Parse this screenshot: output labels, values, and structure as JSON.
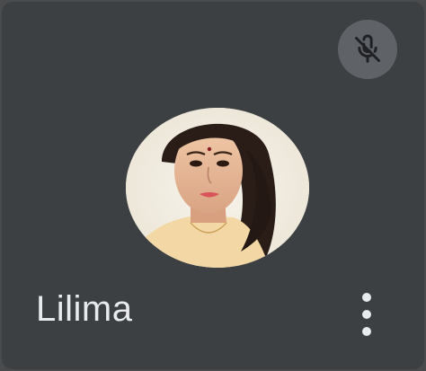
{
  "participant": {
    "name": "Lilima",
    "microphone_state": "muted",
    "microphone_icon": "mic-off-icon",
    "avatar": "participant-avatar-photo",
    "menu_icon": "more-vert-icon"
  },
  "colors": {
    "tile_background": "#3c4043",
    "page_background": "#4a4b4d",
    "badge_background": "#5f6368",
    "text": "#e8eaed"
  }
}
